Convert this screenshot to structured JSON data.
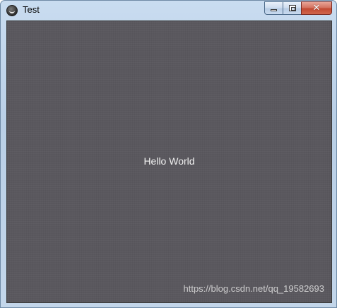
{
  "window": {
    "title": "Test",
    "app_icon": "kivy-logo-icon",
    "buttons": {
      "minimize_icon": "minimize-icon",
      "maximize_icon": "maximize-icon",
      "close_icon": "close-icon",
      "close_glyph": "✕"
    }
  },
  "content": {
    "label": "Hello World",
    "background_color": "#5a585e",
    "text_color": "#f2f2f2"
  },
  "watermark": {
    "text": "https://blog.csdn.net/qq_19582693"
  }
}
